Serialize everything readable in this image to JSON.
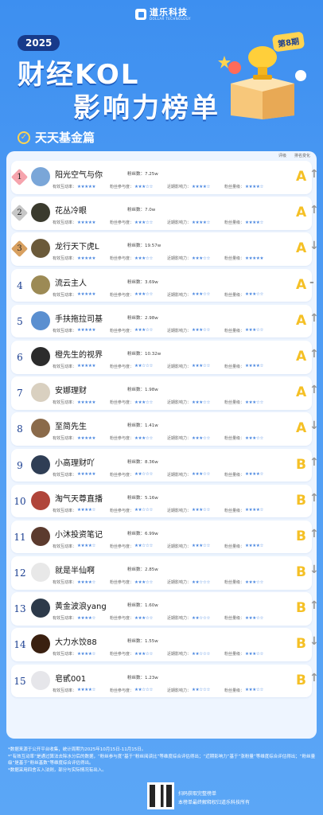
{
  "brand": {
    "name": "道乐科技",
    "sub": "DOLLAR TECHNOLOGY"
  },
  "header": {
    "year": "2025",
    "title_line1": "财经KOL",
    "title_line2": "影响力榜单",
    "issue": "第8期",
    "subtitle": "天天基金篇"
  },
  "columns": {
    "grade": "评级",
    "trend": "排名变化"
  },
  "labels": {
    "fans": "粉丝数：",
    "interaction": "有效互动率：",
    "fan_engagement": "粉丝参与度：",
    "influence": "近期影响力：",
    "fan_quality": "粉丝量级："
  },
  "rows": [
    {
      "rank": "1",
      "name": "阳光空气与你",
      "fans": "7.25w",
      "s1": "★★★★★",
      "s2": "★★★☆☆",
      "s3": "★★★★☆",
      "s4": "★★★★☆",
      "grade": "A",
      "trend": "↑"
    },
    {
      "rank": "2",
      "name": "花丛冷眼",
      "fans": "7.0w",
      "s1": "★★★★★",
      "s2": "★★★☆☆",
      "s3": "★★★★☆",
      "s4": "★★★★☆",
      "grade": "A",
      "trend": "↑"
    },
    {
      "rank": "3",
      "name": "龙行天下虎L",
      "fans": "19.57w",
      "s1": "★★★★★",
      "s2": "★★★☆☆",
      "s3": "★★★☆☆",
      "s4": "★★★★★",
      "grade": "A",
      "trend": "↓"
    },
    {
      "rank": "4",
      "name": "流云主人",
      "fans": "3.69w",
      "s1": "★★★★★",
      "s2": "★★★☆☆",
      "s3": "★★★☆☆",
      "s4": "★★★☆☆",
      "grade": "A",
      "trend": "-"
    },
    {
      "rank": "5",
      "name": "手扶拖拉司基",
      "fans": "2.98w",
      "s1": "★★★★★",
      "s2": "★★★☆☆",
      "s3": "★★★☆☆",
      "s4": "★★★☆☆",
      "grade": "A",
      "trend": "↑"
    },
    {
      "rank": "6",
      "name": "橙先生的视界",
      "fans": "10.32w",
      "s1": "★★★★★",
      "s2": "★★☆☆☆",
      "s3": "★★★☆☆",
      "s4": "★★★★☆",
      "grade": "A",
      "trend": "↑"
    },
    {
      "rank": "7",
      "name": "安娜理财",
      "fans": "1.98w",
      "s1": "★★★★★",
      "s2": "★★★☆☆",
      "s3": "★★★☆☆",
      "s4": "★★★☆☆",
      "grade": "A",
      "trend": "↑"
    },
    {
      "rank": "8",
      "name": "至简先生",
      "fans": "1.41w",
      "s1": "★★★★★",
      "s2": "★★★☆☆",
      "s3": "★★★☆☆",
      "s4": "★★★☆☆",
      "grade": "A",
      "trend": "↓"
    },
    {
      "rank": "9",
      "name": "小高理财吖",
      "fans": "8.36w",
      "s1": "★★★★★",
      "s2": "★★☆☆☆",
      "s3": "★★★☆☆",
      "s4": "★★★★☆",
      "grade": "B",
      "trend": "↑"
    },
    {
      "rank": "10",
      "name": "淘气天尊直播",
      "fans": "5.16w",
      "s1": "★★★★☆",
      "s2": "★★☆☆☆",
      "s3": "★★★☆☆",
      "s4": "★★★★☆",
      "grade": "B",
      "trend": "↑"
    },
    {
      "rank": "11",
      "name": "小沐投资笔记",
      "fans": "6.99w",
      "s1": "★★★★☆",
      "s2": "★★☆☆☆",
      "s3": "★★★☆☆",
      "s4": "★★★★☆",
      "grade": "B",
      "trend": "↑"
    },
    {
      "rank": "12",
      "name": "就是半仙啊",
      "fans": "2.85w",
      "s1": "★★★★☆",
      "s2": "★★★☆☆",
      "s3": "★★☆☆☆",
      "s4": "★★★☆☆",
      "grade": "B",
      "trend": "↓"
    },
    {
      "rank": "13",
      "name": "黄金波浪yang",
      "fans": "1.60w",
      "s1": "★★★★☆",
      "s2": "★★★☆☆",
      "s3": "★★☆☆☆",
      "s4": "★★★☆☆",
      "grade": "B",
      "trend": "↑"
    },
    {
      "rank": "14",
      "name": "大力水饺88",
      "fans": "1.55w",
      "s1": "★★★★☆",
      "s2": "★★★☆☆",
      "s3": "★★☆☆☆",
      "s4": "★★★☆☆",
      "grade": "B",
      "trend": "↓"
    },
    {
      "rank": "15",
      "name": "皂甙001",
      "fans": "1.23w",
      "s1": "★★★★☆",
      "s2": "★★☆☆☆",
      "s3": "★★☆☆☆",
      "s4": "★★★☆☆",
      "grade": "B",
      "trend": "↑"
    }
  ],
  "notes": [
    "*数据来源于公开平台收集，统计周期为2025年10月15日-11月15日。",
    "*“有效互动率”是通过算法去除水分后的数据，“粉丝参与度”基于“粉丝阅读比”等维度综合评估得出；“近期影响力”基于“涨粉量”等维度综合评估得出；“粉丝量级”是基于“粉丝基数”等维度综合评估得出。",
    "*数据采用四舍五入法则，部分与实际情况有出入。"
  ],
  "qr": {
    "line1": "扫码获取完整榜单",
    "line2": "本榜单最终解释权归道乐科技所有"
  },
  "colors": {
    "accent": "#3d8ff0",
    "grade": "#f5c025",
    "star": "#4a87e0"
  }
}
